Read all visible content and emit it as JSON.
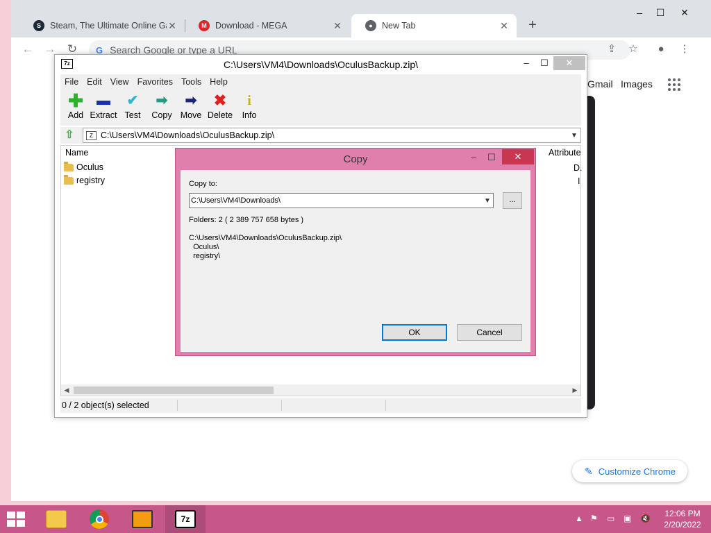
{
  "chrome": {
    "tabs": [
      {
        "title": "Steam, The Ultimate Online Gam",
        "icon": "steam-icon",
        "active": false
      },
      {
        "title": "Download - MEGA",
        "icon": "mega-icon",
        "active": false
      },
      {
        "title": "New Tab",
        "icon": "chrome-icon",
        "active": true
      }
    ],
    "new_tab_symbol": "+",
    "omnibox_placeholder": "Search Google or type a URL",
    "ntp_links": [
      "Gmail",
      "Images"
    ],
    "customize_label": "Customize Chrome",
    "accent": "#1a73e8"
  },
  "sevenzip": {
    "title": "C:\\Users\\VM4\\Downloads\\OculusBackup.zip\\",
    "menu": [
      "File",
      "Edit",
      "View",
      "Favorites",
      "Tools",
      "Help"
    ],
    "toolbar": [
      {
        "label": "Add",
        "icon": "add-icon",
        "color": "#2bb32b"
      },
      {
        "label": "Extract",
        "icon": "extract-icon",
        "color": "#1a2fb5"
      },
      {
        "label": "Test",
        "icon": "test-icon",
        "color": "#2ab8c9"
      },
      {
        "label": "Copy",
        "icon": "copy-icon",
        "color": "#1e9c84"
      },
      {
        "label": "Move",
        "icon": "move-icon",
        "color": "#1a237e"
      },
      {
        "label": "Delete",
        "icon": "delete-icon",
        "color": "#e02020"
      },
      {
        "label": "Info",
        "icon": "info-icon",
        "color": "#c9b400"
      }
    ],
    "address": "C:\\Users\\VM4\\Downloads\\OculusBackup.zip\\",
    "columns": {
      "name": "Name",
      "attributes": "Attribute"
    },
    "files": [
      {
        "name": "Oculus",
        "attr": "D."
      },
      {
        "name": "registry",
        "attr": "I"
      }
    ],
    "status": "0 / 2 object(s) selected"
  },
  "copy_dialog": {
    "title": "Copy",
    "copy_to_label": "Copy to:",
    "destination": "C:\\Users\\VM4\\Downloads\\",
    "browse_label": "...",
    "info": "Folders: 2    ( 2 389 757 658 bytes )",
    "source_lines": "C:\\Users\\VM4\\Downloads\\OculusBackup.zip\\\n  Oculus\\\n  registry\\",
    "ok_label": "OK",
    "cancel_label": "Cancel",
    "frame_color": "#e07fab"
  },
  "taskbar": {
    "apps": [
      {
        "name": "file-explorer",
        "icon": "folder-icon"
      },
      {
        "name": "chrome",
        "icon": "chrome-icon"
      },
      {
        "name": "monitor-app",
        "icon": "monitor-icon"
      },
      {
        "name": "7-zip",
        "icon": "7zip-icon",
        "label": "7z"
      }
    ],
    "time": "12:06 PM",
    "date": "2/20/2022"
  }
}
